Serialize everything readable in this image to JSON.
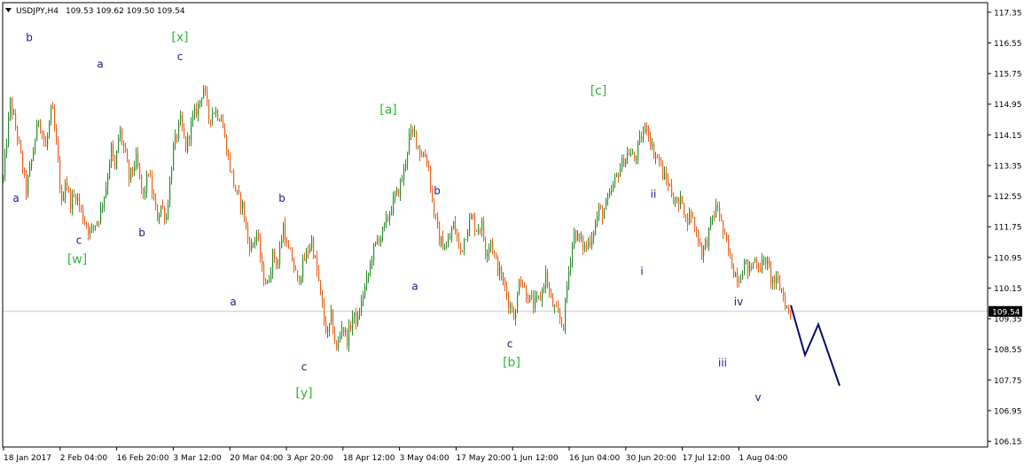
{
  "header": {
    "symbol": "USDJPY,H4",
    "ohlc": "109.53 109.62 109.50 109.54"
  },
  "colors": {
    "background": "#ffffff",
    "frame": "#000000",
    "bull_candle": "#2e8b2e",
    "bear_candle": "#e8611a",
    "price_line": "#c8c8c8",
    "price_badge_bg": "#000000",
    "price_badge_text": "#ffffff",
    "wave_minor": "#1a1a8c",
    "wave_major": "#33b533",
    "projection": "#0a0a6e"
  },
  "chart_data": {
    "type": "candlestick",
    "x_tick_labels": [
      "18 Jan 2017",
      "2 Feb 04:00",
      "16 Feb 20:00",
      "3 Mar 12:00",
      "20 Mar 04:00",
      "3 Apr 20:00",
      "18 Apr 12:00",
      "3 May 04:00",
      "17 May 20:00",
      "1 Jun 12:00",
      "16 Jun 04:00",
      "30 Jun 20:00",
      "17 Jul 12:00",
      "1 Aug 04:00"
    ],
    "y_tick_labels": [
      "117.35",
      "116.55",
      "115.75",
      "114.95",
      "114.15",
      "113.35",
      "112.55",
      "111.75",
      "110.95",
      "110.15",
      "109.35",
      "108.55",
      "107.75",
      "106.95",
      "106.15"
    ],
    "ylim": [
      106.0,
      117.6
    ],
    "current_price": "109.54",
    "path_x": [
      0.0,
      0.8,
      1.7,
      2.6,
      3.3,
      4.0,
      4.8,
      5.5,
      6.2,
      6.6,
      7.0,
      7.6,
      8.2,
      9.0,
      9.8,
      10.8,
      11.6,
      12.2,
      12.6,
      13.1,
      13.8,
      14.2,
      15.0,
      15.8,
      16.4,
      17.0,
      17.4,
      17.8,
      18.4,
      19.2,
      20.0,
      20.6,
      21.3,
      22.0,
      22.6,
      23.2,
      23.8,
      24.6,
      25.5,
      26.3,
      27.0,
      27.6,
      28.0,
      28.6,
      29.2,
      29.8,
      30.4,
      31.0,
      31.6,
      32.0,
      32.6,
      33.2,
      34.0,
      34.8,
      35.6,
      36.2,
      36.6,
      37.0,
      37.6,
      38.2,
      38.8,
      39.4,
      40.0,
      40.6,
      41.1,
      41.6,
      42.2,
      42.8,
      43.4,
      44.0,
      44.6,
      45.2,
      45.8,
      46.4,
      47.0,
      47.6,
      48.0,
      48.4,
      49.2,
      50.0,
      50.8,
      51.6,
      52.2,
      52.8,
      53.4,
      54.0,
      54.4,
      55.0,
      55.6,
      56.4,
      57.0,
      57.4,
      57.8,
      58.2,
      59.0,
      59.8,
      60.6,
      61.2,
      61.8,
      62.4,
      62.8,
      63.2,
      63.6,
      64.0,
      64.4,
      65.0,
      65.6,
      66.2,
      66.9,
      67.2,
      67.6,
      68.2,
      68.8,
      69.4,
      70.0,
      70.6,
      71.2,
      71.6,
      72.0,
      72.6,
      73.2,
      73.6,
      74.0,
      74.4,
      75.0,
      75.6,
      76.2,
      76.6,
      77.0,
      77.6,
      78.2,
      78.8,
      79.4,
      80.0,
      80.6,
      81.2,
      81.8,
      82.4,
      83.0,
      83.6,
      84.2,
      84.8,
      85.4,
      86.0,
      86.6,
      87.2,
      87.8,
      88.4,
      88.9
    ],
    "path_price": [
      113.0,
      115.0,
      114.0,
      112.7,
      113.6,
      114.6,
      113.8,
      114.9,
      113.4,
      112.3,
      113.0,
      112.4,
      112.6,
      112.0,
      111.6,
      112.0,
      112.8,
      113.8,
      113.2,
      114.3,
      113.6,
      113.0,
      113.5,
      112.5,
      113.2,
      112.4,
      112.0,
      112.3,
      112.0,
      113.8,
      114.5,
      113.8,
      114.5,
      114.9,
      115.4,
      114.6,
      114.8,
      114.6,
      113.4,
      112.6,
      112.3,
      111.4,
      111.2,
      111.6,
      110.6,
      110.2,
      111.0,
      110.8,
      111.8,
      111.2,
      110.9,
      110.3,
      110.9,
      111.4,
      110.3,
      109.3,
      108.9,
      109.4,
      108.5,
      109.2,
      108.8,
      109.4,
      109.3,
      110.0,
      110.4,
      111.0,
      111.4,
      111.6,
      112.0,
      112.4,
      112.7,
      113.2,
      114.1,
      114.2,
      113.7,
      113.6,
      113.3,
      112.4,
      111.4,
      111.2,
      111.8,
      111.1,
      111.6,
      112.0,
      111.7,
      111.8,
      111.1,
      111.4,
      110.8,
      110.3,
      109.8,
      109.6,
      109.4,
      110.5,
      110.0,
      109.7,
      109.9,
      110.5,
      109.8,
      109.5,
      109.3,
      109.2,
      110.2,
      111.0,
      111.6,
      111.4,
      111.2,
      111.4,
      111.9,
      112.2,
      112.1,
      112.4,
      112.8,
      113.2,
      113.5,
      113.7,
      113.5,
      113.8,
      114.1,
      114.4,
      113.8,
      113.6,
      113.5,
      113.1,
      112.9,
      112.5,
      112.3,
      112.5,
      111.9,
      112.1,
      111.6,
      111.1,
      111.4,
      112.0,
      112.3,
      111.6,
      111.1,
      110.6,
      110.4,
      110.8,
      110.6,
      110.9,
      110.7,
      110.9,
      110.4,
      110.3,
      110.1,
      109.6,
      109.4,
      109.54
    ],
    "projection": {
      "x": [
        88.9,
        90.5,
        92.0,
        94.4
      ],
      "price": [
        109.7,
        108.4,
        109.2,
        107.6
      ]
    },
    "wave_labels": [
      {
        "text": "b",
        "x": 3.0,
        "price": 116.6,
        "color": "minor"
      },
      {
        "text": "a",
        "x": 1.5,
        "price": 112.4,
        "color": "minor"
      },
      {
        "text": "c",
        "x": 8.6,
        "price": 111.3,
        "color": "minor"
      },
      {
        "text": "[w]",
        "x": 8.4,
        "price": 110.8,
        "color": "major"
      },
      {
        "text": "a",
        "x": 11.0,
        "price": 115.9,
        "color": "minor"
      },
      {
        "text": "b",
        "x": 15.7,
        "price": 111.5,
        "color": "minor"
      },
      {
        "text": "[x]",
        "x": 20.0,
        "price": 116.6,
        "color": "major"
      },
      {
        "text": "c",
        "x": 20.0,
        "price": 116.1,
        "color": "minor"
      },
      {
        "text": "a",
        "x": 26.0,
        "price": 109.7,
        "color": "minor"
      },
      {
        "text": "b",
        "x": 31.5,
        "price": 112.4,
        "color": "minor"
      },
      {
        "text": "c",
        "x": 34.0,
        "price": 108.0,
        "color": "minor"
      },
      {
        "text": "[y]",
        "x": 34.0,
        "price": 107.3,
        "color": "major"
      },
      {
        "text": "[a]",
        "x": 43.5,
        "price": 114.7,
        "color": "major"
      },
      {
        "text": "b",
        "x": 49.0,
        "price": 112.6,
        "color": "minor"
      },
      {
        "text": "a",
        "x": 46.5,
        "price": 110.1,
        "color": "minor"
      },
      {
        "text": "c",
        "x": 57.2,
        "price": 108.6,
        "color": "minor"
      },
      {
        "text": "[b]",
        "x": 57.4,
        "price": 108.1,
        "color": "major"
      },
      {
        "text": "[c]",
        "x": 67.2,
        "price": 115.2,
        "color": "major"
      },
      {
        "text": "ii",
        "x": 73.4,
        "price": 112.5,
        "color": "minor"
      },
      {
        "text": "i",
        "x": 72.1,
        "price": 110.5,
        "color": "minor"
      },
      {
        "text": "iii",
        "x": 81.2,
        "price": 108.1,
        "color": "minor"
      },
      {
        "text": "iv",
        "x": 83.0,
        "price": 109.7,
        "color": "minor"
      },
      {
        "text": "v",
        "x": 85.2,
        "price": 107.2,
        "color": "minor"
      }
    ]
  }
}
